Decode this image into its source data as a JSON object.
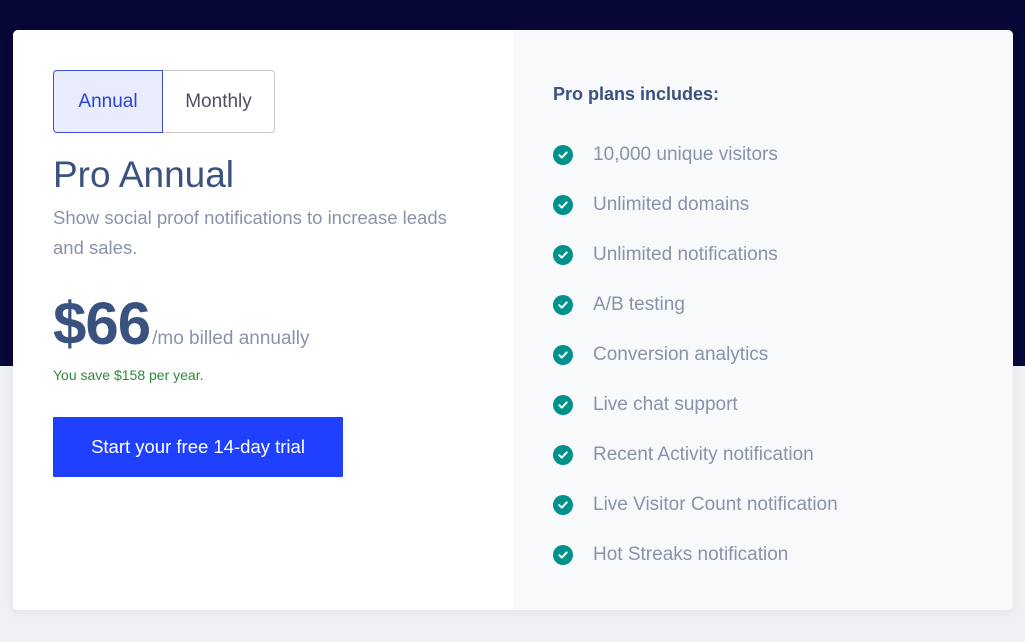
{
  "colors": {
    "brand_blue": "#1f41ff",
    "heading": "#3a5280",
    "muted_text": "#8893ab",
    "check_teal": "#00928a",
    "savings_green": "#2e8a3a",
    "dark_band": "#070738"
  },
  "billing_toggle": {
    "annual_label": "Annual",
    "monthly_label": "Monthly",
    "selected": "Annual"
  },
  "plan": {
    "title": "Pro Annual",
    "description": "Show social proof notifications to increase leads and sales.",
    "price": "$66",
    "price_unit": "/mo billed annually",
    "savings": "You save $158 per year.",
    "cta_label": "Start your free 14-day trial"
  },
  "includes": {
    "heading": "Pro plans includes:",
    "icon": "check-circle-icon",
    "features": [
      "10,000 unique visitors",
      "Unlimited domains",
      "Unlimited notifications",
      "A/B testing",
      "Conversion analytics",
      "Live chat support",
      "Recent Activity notification",
      "Live Visitor Count notification",
      "Hot Streaks notification"
    ]
  }
}
